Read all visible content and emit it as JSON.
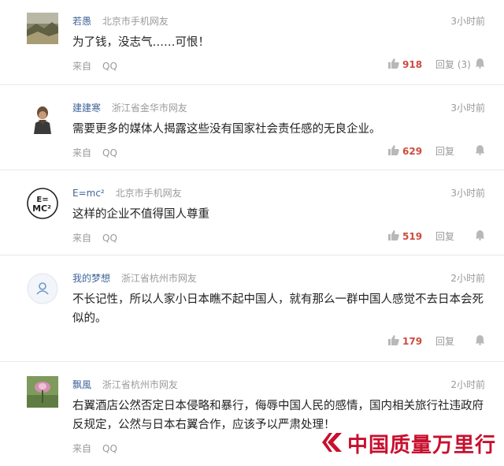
{
  "comments": [
    {
      "user": "若愚",
      "location": "北京市手机网友",
      "time": "3小时前",
      "text": "为了钱，没志气……可恨！",
      "source": "来自",
      "client": "QQ",
      "likes": "918",
      "reply": "回复 (3)"
    },
    {
      "user": "建建寒",
      "location": "浙江省金华市网友",
      "time": "3小时前",
      "text": "需要更多的媒体人揭露这些没有国家社会责任感的无良企业。",
      "source": "来自",
      "client": "QQ",
      "likes": "629",
      "reply": "回复"
    },
    {
      "user": "E=mc²",
      "location": "北京市手机网友",
      "time": "3小时前",
      "text": "这样的企业不值得国人尊重",
      "source": "来自",
      "client": "QQ",
      "likes": "519",
      "reply": "回复",
      "avatar_text": "E=MC²"
    },
    {
      "user": "我的梦想",
      "location": "浙江省杭州市网友",
      "time": "2小时前",
      "text": "不长记性，所以人家小日本瞧不起中国人，就有那么一群中国人感觉不去日本会死似的。",
      "source": "",
      "client": "",
      "likes": "179",
      "reply": "回复"
    },
    {
      "user": "飘風",
      "location": "浙江省杭州市网友",
      "time": "2小时前",
      "text": "右翼酒店公然否定日本侵略和暴行，侮辱中国人民的感情，国内相关旅行社违政府反规定，公然与日本右翼合作，应该予以严肃处理！",
      "source": "来自",
      "client": "QQ"
    }
  ],
  "watermark": "中国质量万里行",
  "colors": {
    "username": "#406599",
    "like_count": "#d04a3e",
    "muted": "#9a9a9a",
    "watermark": "#c8102e"
  },
  "icons": {
    "like": "thumbs-up-icon",
    "notify": "bell-icon",
    "brand": "logo-icon"
  }
}
